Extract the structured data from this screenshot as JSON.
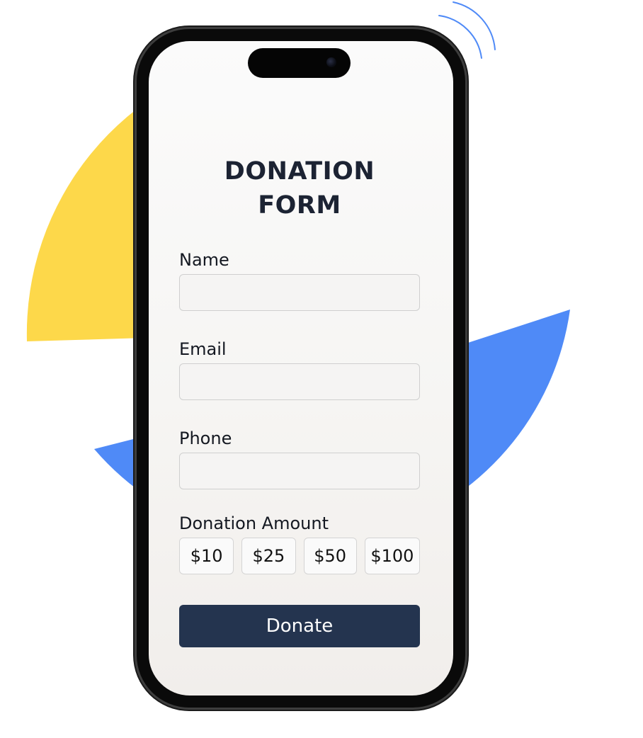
{
  "form": {
    "title": "DONATION FORM",
    "fields": [
      {
        "label": "Name",
        "value": "",
        "placeholder": ""
      },
      {
        "label": "Email",
        "value": "",
        "placeholder": ""
      },
      {
        "label": "Phone",
        "value": "",
        "placeholder": ""
      }
    ],
    "amount_label": "Donation Amount",
    "amounts": [
      "$10",
      "$25",
      "$50",
      "$100"
    ],
    "submit_label": "Donate"
  },
  "colors": {
    "accent_blue": "#4f8af7",
    "accent_yellow": "#fdd84a",
    "button_dark": "#24344f",
    "title_text": "#1c2333"
  },
  "icons": [
    "signal-waves-icon"
  ]
}
